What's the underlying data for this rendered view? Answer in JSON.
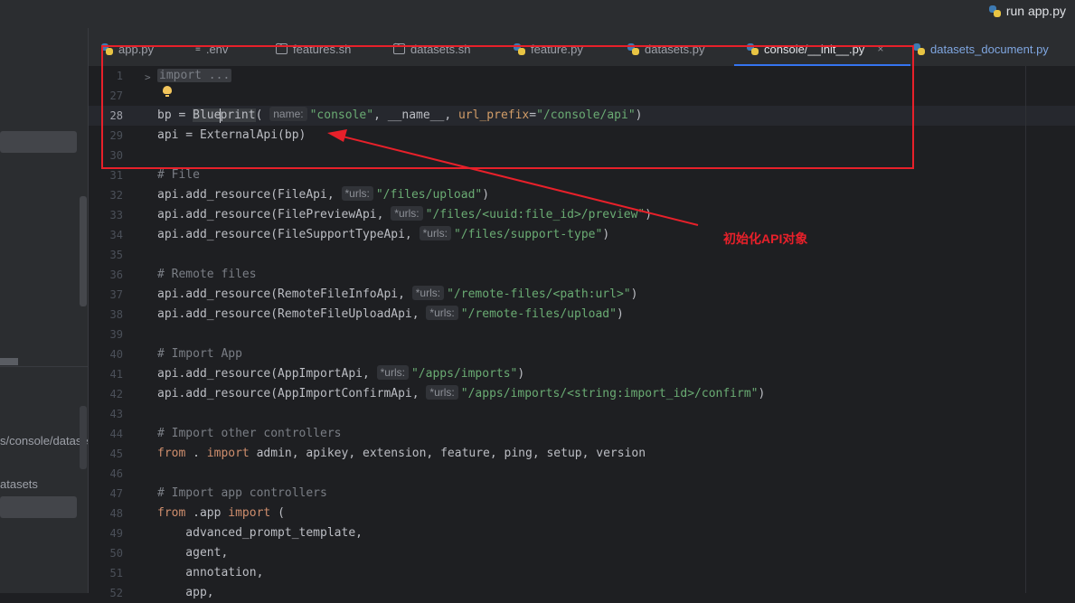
{
  "run_config": {
    "label": "run app.py",
    "icon": "python-icon"
  },
  "left_panel": {
    "path_fragment": "s/console/datase",
    "folder_fragment": "atasets"
  },
  "tabs": [
    {
      "label": "app.py",
      "icon": "python-icon"
    },
    {
      "label": ".env",
      "icon": "env-file-icon"
    },
    {
      "label": "features.sh",
      "icon": "shell-script-icon"
    },
    {
      "label": "datasets.sh",
      "icon": "shell-script-icon"
    },
    {
      "label": "feature.py",
      "icon": "python-icon"
    },
    {
      "label": "datasets.py",
      "icon": "python-icon"
    },
    {
      "label": "console/__init__.py",
      "icon": "python-icon",
      "active": true,
      "close": "×"
    },
    {
      "label": "datasets_document.py",
      "icon": "python-icon"
    }
  ],
  "editor": {
    "line_numbers": [
      "1",
      "27",
      "28",
      "29",
      "30",
      "31",
      "32",
      "33",
      "34",
      "35",
      "36",
      "37",
      "38",
      "39",
      "40",
      "41",
      "42",
      "43",
      "44",
      "45",
      "46",
      "47",
      "48",
      "49",
      "50",
      "51",
      "52"
    ],
    "current_line": "28",
    "fold_marker": ">",
    "folded_import": "import ...",
    "hints": {
      "name": "name:",
      "urls": "*urls:"
    },
    "lines": {
      "l28": {
        "pre": "bp = ",
        "bp_a": "Blue",
        "bp_b": "print",
        "open": "(",
        "s1": "\"console\"",
        "mid": ", __name__, ",
        "param": "url_prefix",
        "eq": "=",
        "s2": "\"/console/api\"",
        "close": ")"
      },
      "l29": "api = ExternalApi(bp)",
      "l31": "# File",
      "l32": {
        "code": "api.add_resource(FileApi, ",
        "str": "\"/files/upload\"",
        "end": ")"
      },
      "l33": {
        "code": "api.add_resource(FilePreviewApi, ",
        "str": "\"/files/<uuid:file_id>/preview\"",
        "end": ")"
      },
      "l34": {
        "code": "api.add_resource(FileSupportTypeApi, ",
        "str": "\"/files/support-type\"",
        "end": ")"
      },
      "l36": "# Remote files",
      "l37": {
        "code": "api.add_resource(RemoteFileInfoApi, ",
        "str": "\"/remote-files/<path:url>\"",
        "end": ")"
      },
      "l38": {
        "code": "api.add_resource(RemoteFileUploadApi, ",
        "str": "\"/remote-files/upload\"",
        "end": ")"
      },
      "l40": "# Import App",
      "l41": {
        "code": "api.add_resource(AppImportApi, ",
        "str": "\"/apps/imports\"",
        "end": ")"
      },
      "l42": {
        "code": "api.add_resource(AppImportConfirmApi, ",
        "str": "\"/apps/imports/<string:import_id>/confirm\"",
        "end": ")"
      },
      "l44": "# Import other controllers",
      "l45": {
        "kw1": "from",
        "dot": " . ",
        "kw2": "import",
        "rest": " admin, apikey, extension, feature, ping, setup, version"
      },
      "l47": "# Import app controllers",
      "l48": {
        "kw1": "from",
        "mod": " .app ",
        "kw2": "import",
        "rest": " ("
      },
      "l49": "    advanced_prompt_template,",
      "l50": "    agent,",
      "l51": "    annotation,",
      "l52": "    app,"
    }
  },
  "annotation": {
    "label": "初始化API对象",
    "color": "#e8202a"
  }
}
